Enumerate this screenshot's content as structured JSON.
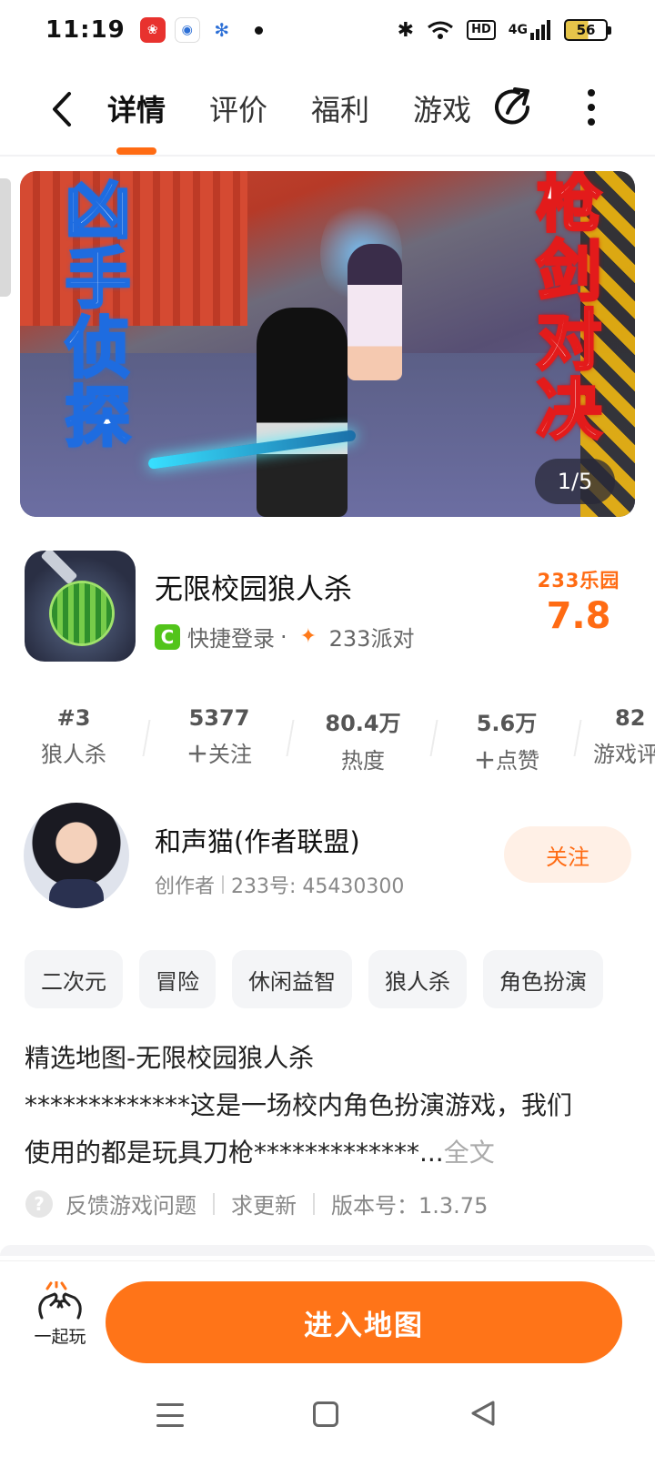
{
  "status_bar": {
    "time": "11:19",
    "network": "4G",
    "hd": "HD",
    "battery": "56"
  },
  "nav": {
    "tabs": [
      "详情",
      "评价",
      "福利",
      "游戏"
    ],
    "active_tab": "详情"
  },
  "banner": {
    "left_text": "凶手侦探",
    "right_text": "枪剑对决",
    "pager": "1/5"
  },
  "app": {
    "title": "无限校园狼人杀",
    "login_label": "快捷登录",
    "separator": "·",
    "party_label": "233派对",
    "score_brand_num": "233",
    "score_brand_text": "乐园",
    "score": "7.8"
  },
  "stats": [
    {
      "num": "#3",
      "label": "狼人杀"
    },
    {
      "num": "5377",
      "label": "关注"
    },
    {
      "num": "80.4万",
      "label": "热度"
    },
    {
      "num": "5.6万",
      "label": "点赞"
    },
    {
      "num": "82",
      "label": "游戏评"
    }
  ],
  "author": {
    "name": "和声猫(作者联盟)",
    "role": "创作者",
    "id_text": "233号: 45430300",
    "follow_label": "关注"
  },
  "tags": [
    "二次元",
    "冒险",
    "休闲益智",
    "狼人杀",
    "角色扮演"
  ],
  "description": {
    "line1": "精选地图-无限校园狼人杀",
    "line2": "*************这是一场校内角色扮演游戏，我们",
    "line3": "使用的都是玩具刀枪*************...",
    "more": "全文"
  },
  "footer_links": {
    "feedback": "反馈游戏问题",
    "request_update": "求更新",
    "version": "版本号：1.3.75"
  },
  "bottom": {
    "play_together": "一起玩",
    "enter": "进入地图"
  },
  "colors": {
    "accent": "#ff7418",
    "follow_bg": "#fff0e6"
  }
}
